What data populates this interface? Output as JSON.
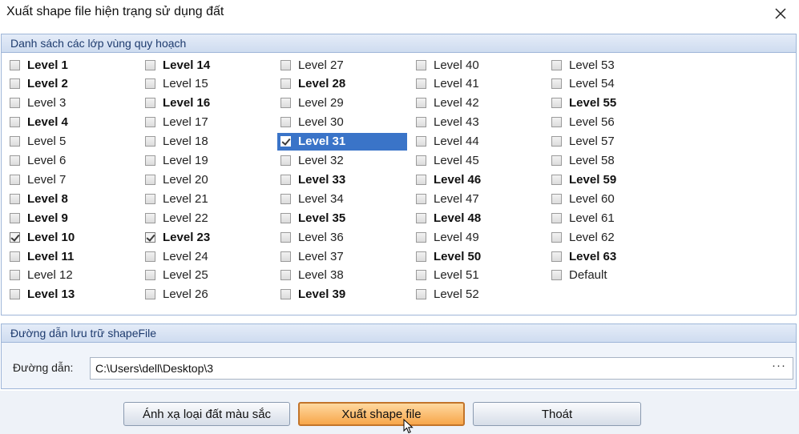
{
  "window": {
    "title": "Xuất shape file hiện trạng sử dụng đất"
  },
  "layers_group": {
    "header": "Danh sách các lớp vùng quy hoạch",
    "columns": [
      [
        {
          "label": "Level 1",
          "bold": true,
          "checked": false
        },
        {
          "label": "Level 2",
          "bold": true,
          "checked": false
        },
        {
          "label": "Level 3",
          "bold": false,
          "checked": false
        },
        {
          "label": "Level 4",
          "bold": true,
          "checked": false
        },
        {
          "label": "Level 5",
          "bold": false,
          "checked": false
        },
        {
          "label": "Level 6",
          "bold": false,
          "checked": false
        },
        {
          "label": "Level 7",
          "bold": false,
          "checked": false
        },
        {
          "label": "Level 8",
          "bold": true,
          "checked": false
        },
        {
          "label": "Level 9",
          "bold": true,
          "checked": false
        },
        {
          "label": "Level 10",
          "bold": true,
          "checked": true
        },
        {
          "label": "Level 11",
          "bold": true,
          "checked": false
        },
        {
          "label": "Level 12",
          "bold": false,
          "checked": false
        },
        {
          "label": "Level 13",
          "bold": true,
          "checked": false
        }
      ],
      [
        {
          "label": "Level 14",
          "bold": true,
          "checked": false
        },
        {
          "label": "Level 15",
          "bold": false,
          "checked": false
        },
        {
          "label": "Level 16",
          "bold": true,
          "checked": false
        },
        {
          "label": "Level 17",
          "bold": false,
          "checked": false
        },
        {
          "label": "Level 18",
          "bold": false,
          "checked": false
        },
        {
          "label": "Level 19",
          "bold": false,
          "checked": false
        },
        {
          "label": "Level 20",
          "bold": false,
          "checked": false
        },
        {
          "label": "Level 21",
          "bold": false,
          "checked": false
        },
        {
          "label": "Level 22",
          "bold": false,
          "checked": false
        },
        {
          "label": "Level 23",
          "bold": true,
          "checked": true
        },
        {
          "label": "Level 24",
          "bold": false,
          "checked": false
        },
        {
          "label": "Level 25",
          "bold": false,
          "checked": false
        },
        {
          "label": "Level 26",
          "bold": false,
          "checked": false
        }
      ],
      [
        {
          "label": "Level 27",
          "bold": false,
          "checked": false
        },
        {
          "label": "Level 28",
          "bold": true,
          "checked": false
        },
        {
          "label": "Level 29",
          "bold": false,
          "checked": false
        },
        {
          "label": "Level 30",
          "bold": false,
          "checked": false
        },
        {
          "label": "Level 31",
          "bold": true,
          "checked": true,
          "selected": true
        },
        {
          "label": "Level 32",
          "bold": false,
          "checked": false
        },
        {
          "label": "Level 33",
          "bold": true,
          "checked": false
        },
        {
          "label": "Level 34",
          "bold": false,
          "checked": false
        },
        {
          "label": "Level 35",
          "bold": true,
          "checked": false
        },
        {
          "label": "Level 36",
          "bold": false,
          "checked": false
        },
        {
          "label": "Level 37",
          "bold": false,
          "checked": false
        },
        {
          "label": "Level 38",
          "bold": false,
          "checked": false
        },
        {
          "label": "Level 39",
          "bold": true,
          "checked": false
        }
      ],
      [
        {
          "label": "Level 40",
          "bold": false,
          "checked": false
        },
        {
          "label": "Level 41",
          "bold": false,
          "checked": false
        },
        {
          "label": "Level 42",
          "bold": false,
          "checked": false
        },
        {
          "label": "Level 43",
          "bold": false,
          "checked": false
        },
        {
          "label": "Level 44",
          "bold": false,
          "checked": false
        },
        {
          "label": "Level 45",
          "bold": false,
          "checked": false
        },
        {
          "label": "Level 46",
          "bold": true,
          "checked": false
        },
        {
          "label": "Level 47",
          "bold": false,
          "checked": false
        },
        {
          "label": "Level 48",
          "bold": true,
          "checked": false
        },
        {
          "label": "Level 49",
          "bold": false,
          "checked": false
        },
        {
          "label": "Level 50",
          "bold": true,
          "checked": false
        },
        {
          "label": "Level 51",
          "bold": false,
          "checked": false
        },
        {
          "label": "Level 52",
          "bold": false,
          "checked": false
        }
      ],
      [
        {
          "label": "Level 53",
          "bold": false,
          "checked": false
        },
        {
          "label": "Level 54",
          "bold": false,
          "checked": false
        },
        {
          "label": "Level 55",
          "bold": true,
          "checked": false
        },
        {
          "label": "Level 56",
          "bold": false,
          "checked": false
        },
        {
          "label": "Level 57",
          "bold": false,
          "checked": false
        },
        {
          "label": "Level 58",
          "bold": false,
          "checked": false
        },
        {
          "label": "Level 59",
          "bold": true,
          "checked": false
        },
        {
          "label": "Level 60",
          "bold": false,
          "checked": false
        },
        {
          "label": "Level 61",
          "bold": false,
          "checked": false
        },
        {
          "label": "Level 62",
          "bold": false,
          "checked": false
        },
        {
          "label": "Level 63",
          "bold": true,
          "checked": false
        },
        {
          "label": "Default",
          "bold": false,
          "checked": false
        }
      ]
    ]
  },
  "path_group": {
    "header": "Đường dẫn lưu trữ shapeFile",
    "label": "Đường dẫn:",
    "value": "C:\\Users\\dell\\Desktop\\3",
    "browse": "···"
  },
  "buttons": {
    "map_colors": "Ánh xạ loại đất màu sắc",
    "export": "Xuất shape file",
    "exit": "Thoát"
  },
  "icons": {
    "close": "close-icon",
    "cursor": "mouse-pointer-icon"
  },
  "colors": {
    "selection": "#3a74c8",
    "header": "#cfdcf0",
    "export_button": "#f7a64a"
  }
}
